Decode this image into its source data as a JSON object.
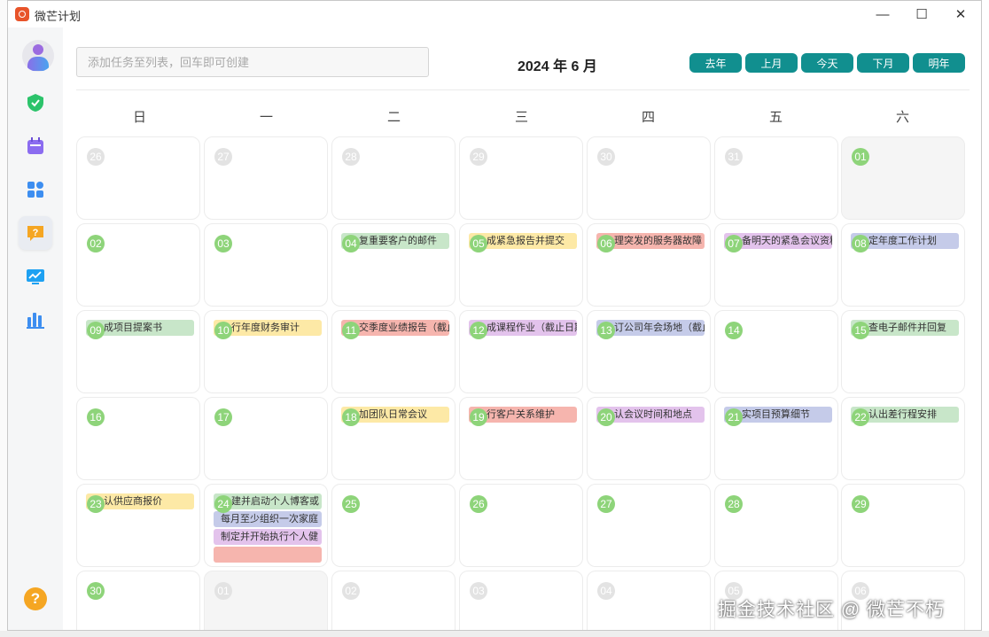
{
  "app": {
    "title": "微芒计划"
  },
  "window_controls": {
    "minimize": "—",
    "maximize": "☐",
    "close": "✕"
  },
  "toolbar": {
    "input_placeholder": "添加任务至列表，回车即可创建",
    "month_title": "2024 年 6 月",
    "buttons": [
      "去年",
      "上月",
      "今天",
      "下月",
      "明年"
    ]
  },
  "weekdays": [
    "日",
    "一",
    "二",
    "三",
    "四",
    "五",
    "六"
  ],
  "colors": {
    "accent": "#118f8f",
    "day_badge": "#8ed47a",
    "task_green": "#c8e6c9",
    "task_yellow": "#fde9a6",
    "task_red": "#f6b5ae",
    "task_purple": "#e3c3ec",
    "task_blue": "#c5cbe9"
  },
  "calendar": [
    {
      "day": "26",
      "other": true
    },
    {
      "day": "27",
      "other": true
    },
    {
      "day": "28",
      "other": true
    },
    {
      "day": "29",
      "other": true
    },
    {
      "day": "30",
      "other": true
    },
    {
      "day": "31",
      "other": true
    },
    {
      "day": "01",
      "other": false,
      "shade": true
    },
    {
      "day": "02",
      "other": false
    },
    {
      "day": "03",
      "other": false
    },
    {
      "day": "04",
      "other": false,
      "tasks": [
        {
          "text": "复重要客户的邮件",
          "color": "#c8e6c9"
        }
      ]
    },
    {
      "day": "05",
      "other": false,
      "tasks": [
        {
          "text": "成紧急报告并提交",
          "color": "#fde9a6"
        }
      ]
    },
    {
      "day": "06",
      "other": false,
      "tasks": [
        {
          "text": "理突发的服务器故障",
          "color": "#f6b5ae"
        }
      ]
    },
    {
      "day": "07",
      "other": false,
      "tasks": [
        {
          "text": "备明天的紧急会议资料",
          "color": "#e3c3ec"
        }
      ]
    },
    {
      "day": "08",
      "other": false,
      "tasks": [
        {
          "text": "定年度工作计划",
          "color": "#c5cbe9"
        }
      ]
    },
    {
      "day": "09",
      "other": false,
      "tasks": [
        {
          "text": "成项目提案书",
          "color": "#c8e6c9"
        }
      ]
    },
    {
      "day": "10",
      "other": false,
      "tasks": [
        {
          "text": "行年度财务审计",
          "color": "#fde9a6"
        }
      ]
    },
    {
      "day": "11",
      "other": false,
      "tasks": [
        {
          "text": "交季度业绩报告（截止",
          "color": "#f6b5ae"
        }
      ]
    },
    {
      "day": "12",
      "other": false,
      "tasks": [
        {
          "text": "成课程作业（截止日期",
          "color": "#e3c3ec"
        }
      ]
    },
    {
      "day": "13",
      "other": false,
      "tasks": [
        {
          "text": "订公司年会场地（截止",
          "color": "#c5cbe9"
        }
      ]
    },
    {
      "day": "14",
      "other": false
    },
    {
      "day": "15",
      "other": false,
      "tasks": [
        {
          "text": "查电子邮件并回复",
          "color": "#c8e6c9"
        }
      ]
    },
    {
      "day": "16",
      "other": false
    },
    {
      "day": "17",
      "other": false
    },
    {
      "day": "18",
      "other": false,
      "tasks": [
        {
          "text": "加团队日常会议",
          "color": "#fde9a6"
        }
      ]
    },
    {
      "day": "19",
      "other": false,
      "tasks": [
        {
          "text": "行客户关系维护",
          "color": "#f6b5ae"
        }
      ]
    },
    {
      "day": "20",
      "other": false,
      "tasks": [
        {
          "text": "认会议时间和地点",
          "color": "#e3c3ec"
        }
      ]
    },
    {
      "day": "21",
      "other": false,
      "tasks": [
        {
          "text": "实项目预算细节",
          "color": "#c5cbe9"
        }
      ]
    },
    {
      "day": "22",
      "other": false,
      "tasks": [
        {
          "text": "认出差行程安排",
          "color": "#c8e6c9"
        }
      ]
    },
    {
      "day": "23",
      "other": false,
      "tasks": [
        {
          "text": "认供应商报价",
          "color": "#fde9a6"
        }
      ]
    },
    {
      "day": "24",
      "other": false,
      "tasks": [
        {
          "text": "建并启动个人博客或",
          "color": "#c8e6c9"
        },
        {
          "text": "每月至少组织一次家庭",
          "color": "#c5cbe9",
          "plain": true
        },
        {
          "text": "制定并开始执行个人健",
          "color": "#e3c3ec",
          "plain": true
        },
        {
          "text": "",
          "color": "#f6b5ae",
          "plain": true
        }
      ]
    },
    {
      "day": "25",
      "other": false
    },
    {
      "day": "26",
      "other": false
    },
    {
      "day": "27",
      "other": false
    },
    {
      "day": "28",
      "other": false
    },
    {
      "day": "29",
      "other": false
    },
    {
      "day": "30",
      "other": false
    },
    {
      "day": "01",
      "other": true,
      "shade": true
    },
    {
      "day": "02",
      "other": true
    },
    {
      "day": "03",
      "other": true
    },
    {
      "day": "04",
      "other": true
    },
    {
      "day": "05",
      "other": true
    },
    {
      "day": "06",
      "other": true
    }
  ],
  "sidebar_icons": [
    "user-avatar",
    "shield-check-icon",
    "calendar-icon",
    "apps-grid-icon",
    "help-chat-icon",
    "monitor-chart-icon",
    "bar-chart-icon"
  ],
  "watermark": "掘金技术社区 @ 微芒不朽"
}
